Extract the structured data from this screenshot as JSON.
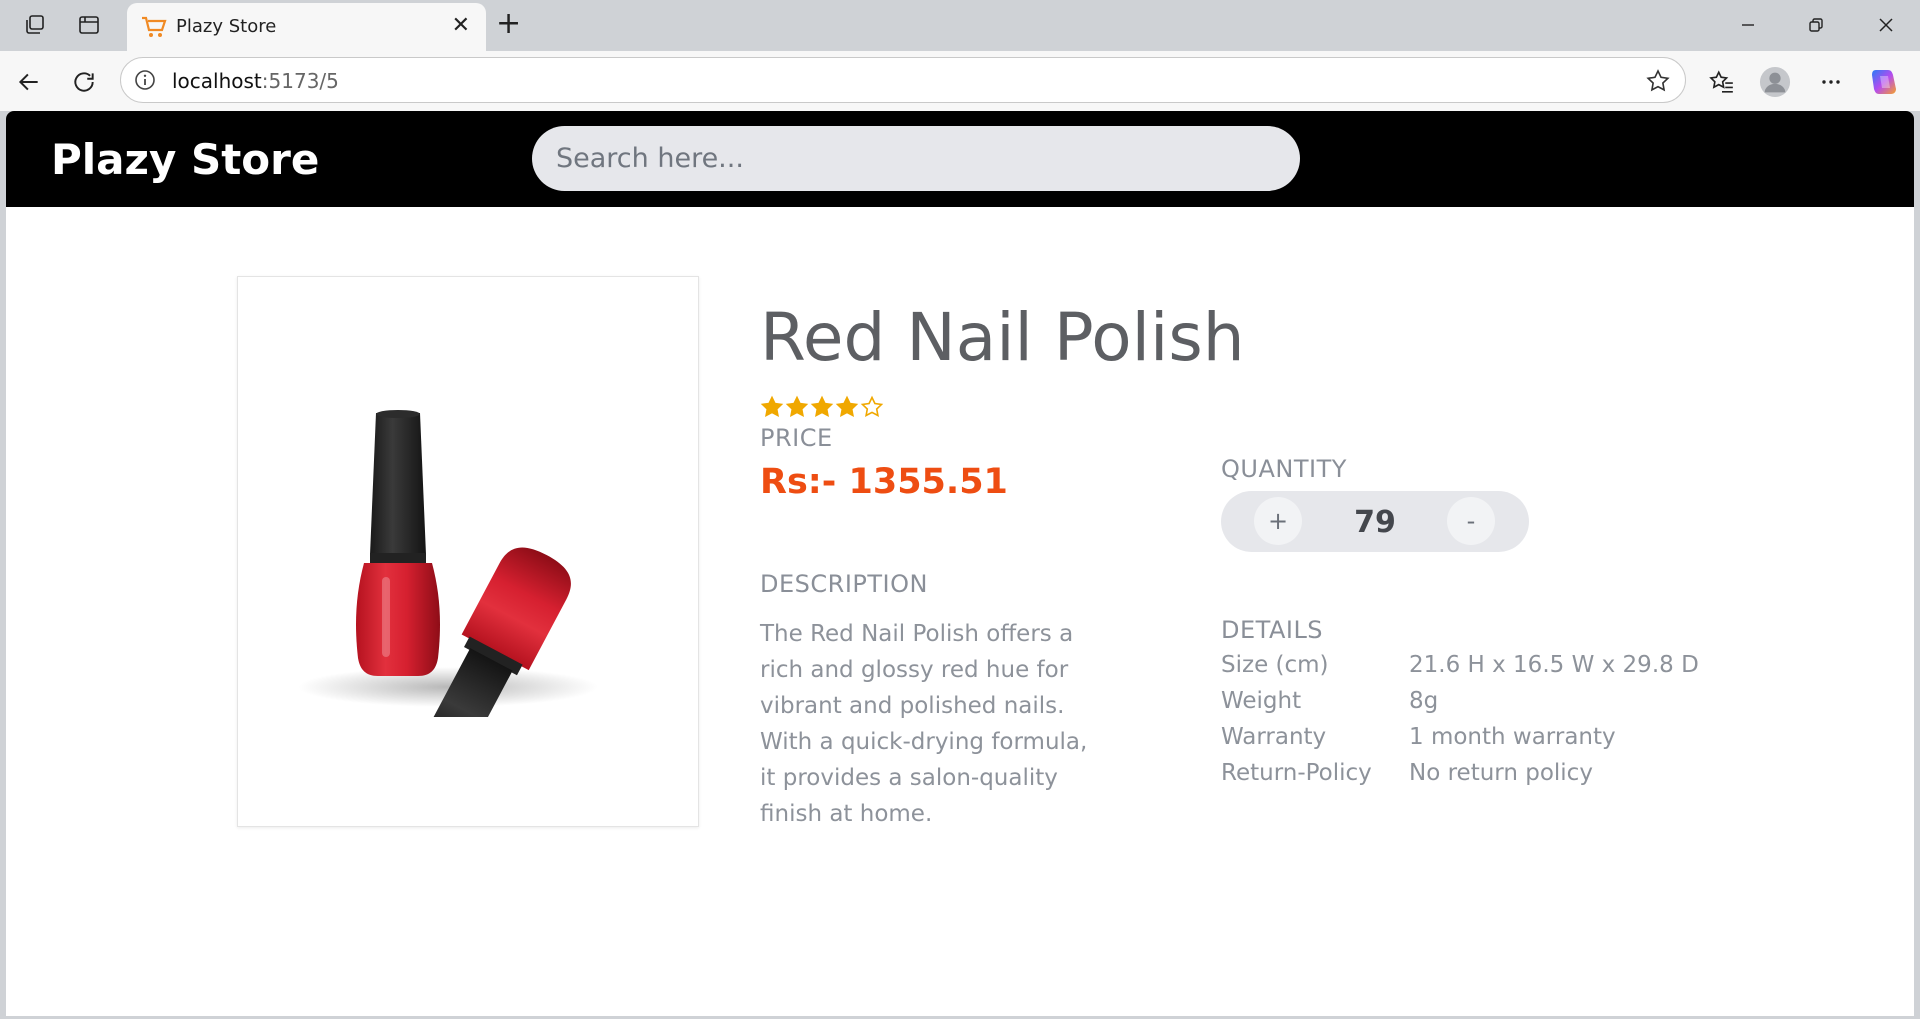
{
  "browser": {
    "tab_title": "Plazy Store",
    "url_host": "localhost",
    "url_path": ":5173/5"
  },
  "site": {
    "brand": "Plazy Store",
    "search_placeholder": "Search here..."
  },
  "product": {
    "name": "Red Nail Polish",
    "rating": 4,
    "rating_max": 5,
    "price_label": "PRICE",
    "price": "Rs:- 1355.51",
    "quantity_label": "QUANTITY",
    "quantity": "79",
    "plus_label": "+",
    "minus_label": "-",
    "description_label": "DESCRIPTION",
    "description": "The Red Nail Polish offers a rich and glossy red hue for vibrant and polished nails. With a quick-drying formula, it provides a salon-quality finish at home.",
    "details_label": "DETAILS",
    "details": [
      {
        "key": "Size (cm)",
        "value": "21.6 H x 16.5 W x 29.8 D"
      },
      {
        "key": "Weight",
        "value": "8g"
      },
      {
        "key": "Warranty",
        "value": "1 month warranty"
      },
      {
        "key": "Return-Policy",
        "value": "No return policy"
      }
    ]
  },
  "colors": {
    "header_bg": "#000000",
    "price": "#ee4d12",
    "star": "#f0a800"
  },
  "icons": [
    "workspaces-icon",
    "tab-actions-icon",
    "cart-favicon",
    "close-icon",
    "new-tab-icon",
    "minimize-icon",
    "restore-icon",
    "window-close-icon",
    "back-icon",
    "refresh-icon",
    "info-icon",
    "favorite-star-icon",
    "favorites-icon",
    "profile-icon",
    "more-icon",
    "copilot-icon"
  ]
}
